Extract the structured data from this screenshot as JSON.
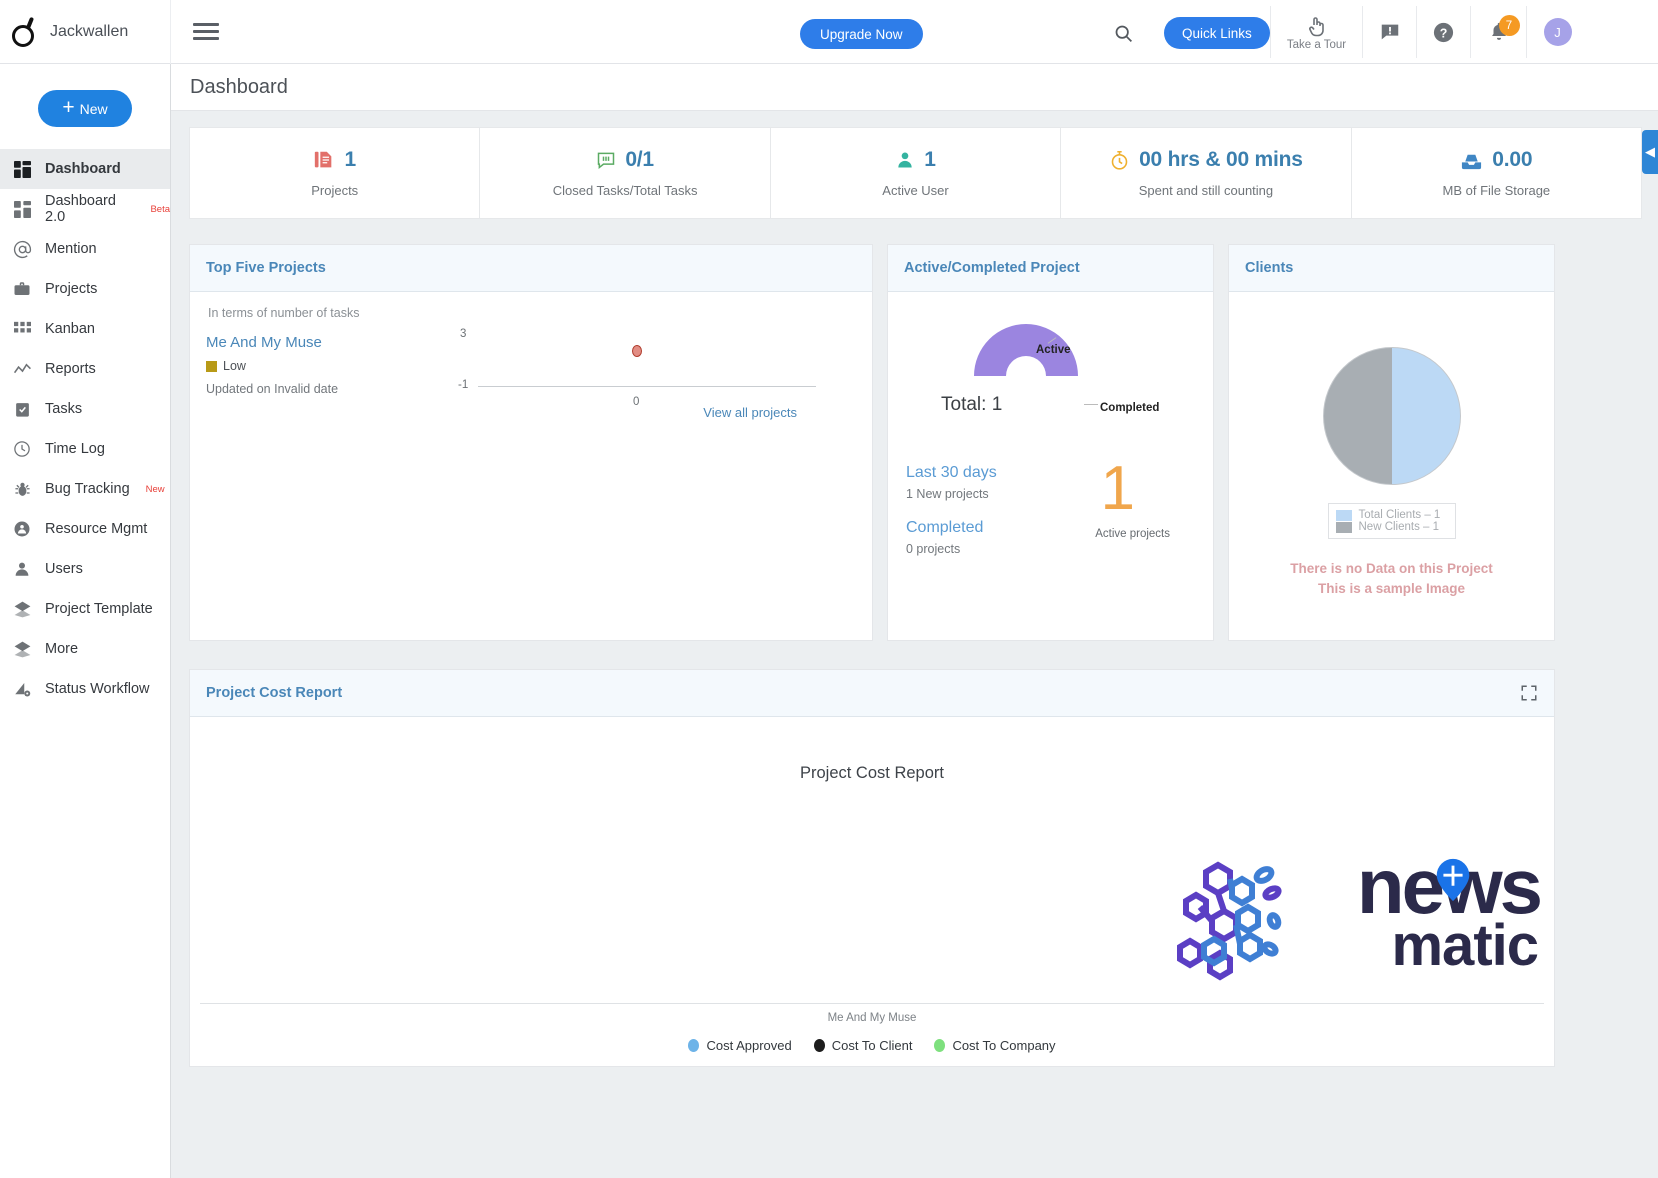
{
  "topbar": {
    "brand_name": "Jackwallen",
    "menu_icon": "hamburger-icon",
    "upgrade_label": "Upgrade Now",
    "search_icon": "search-icon",
    "quick_links_label": "Quick Links",
    "tour_label": "Take a Tour",
    "tour_icon": "hand-pointer-icon",
    "announcement_icon": "announcement-icon",
    "help_icon": "question-circle-icon",
    "bell_icon": "bell-icon",
    "notification_count": "7",
    "avatar_initial": "J"
  },
  "sidebar": {
    "new_label": "New",
    "items": [
      {
        "label": "Dashboard",
        "icon": "dashboard-icon",
        "badge": "",
        "active": true
      },
      {
        "label": "Dashboard 2.0",
        "icon": "dashboard-alt-icon",
        "badge": "Beta",
        "active": false
      },
      {
        "label": "Mention",
        "icon": "at-icon",
        "badge": "",
        "active": false
      },
      {
        "label": "Projects",
        "icon": "briefcase-icon",
        "badge": "",
        "active": false
      },
      {
        "label": "Kanban",
        "icon": "grid-icon",
        "badge": "",
        "active": false
      },
      {
        "label": "Reports",
        "icon": "line-chart-icon",
        "badge": "",
        "active": false
      },
      {
        "label": "Tasks",
        "icon": "clipboard-check-icon",
        "badge": "",
        "active": false
      },
      {
        "label": "Time Log",
        "icon": "clock-icon",
        "badge": "",
        "active": false
      },
      {
        "label": "Bug Tracking",
        "icon": "bug-icon",
        "badge": "New",
        "active": false
      },
      {
        "label": "Resource Mgmt",
        "icon": "users-circle-icon",
        "badge": "",
        "active": false
      },
      {
        "label": "Users",
        "icon": "user-icon",
        "badge": "",
        "active": false
      },
      {
        "label": "Project Template",
        "icon": "layers-icon",
        "badge": "",
        "active": false
      },
      {
        "label": "More",
        "icon": "layers-icon",
        "badge": "",
        "active": false
      },
      {
        "label": "Status Workflow",
        "icon": "workflow-icon",
        "badge": "",
        "active": false
      }
    ]
  },
  "page": {
    "title": "Dashboard"
  },
  "kpis": [
    {
      "value": "1",
      "label": "Projects",
      "icon": "documents-icon",
      "color": "#e2706a"
    },
    {
      "value": "0/1",
      "label": "Closed Tasks/Total Tasks",
      "icon": "task-icon",
      "color": "#5bab63"
    },
    {
      "value": "1",
      "label": "Active User",
      "icon": "person-icon",
      "color": "#34b3a0"
    },
    {
      "value": "00 hrs & 00 mins",
      "label": "Spent and still counting",
      "icon": "stopwatch-icon",
      "color": "#efb02e"
    },
    {
      "value": "0.00",
      "label": "MB of File Storage",
      "icon": "storage-icon",
      "color": "#3f86c4"
    }
  ],
  "top_five": {
    "title": "Top Five Projects",
    "subtitle": "In terms of number of tasks",
    "project_name": "Me And My Muse",
    "priority": "Low",
    "priority_color": "#b89a17",
    "updated": "Updated on Invalid date",
    "view_all_label": "View all projects"
  },
  "active_completed": {
    "title": "Active/Completed Project",
    "label_active": "Active",
    "label_completed": "Completed",
    "total_text": "Total: 1",
    "last30_title": "Last 30 days",
    "last30_sub": "1 New projects",
    "completed_title": "Completed",
    "completed_sub": "0 projects",
    "big_number": "1",
    "big_number_label": "Active projects",
    "arc_color": "#9b85e0"
  },
  "clients": {
    "title": "Clients",
    "legend": [
      {
        "label": "Total Clients – 1",
        "color": "#bcd9f5"
      },
      {
        "label": "New Clients – 1",
        "color": "#a8aeb3"
      }
    ],
    "no_data_line1": "There is no Data on this Project",
    "no_data_line2": "This is a sample Image"
  },
  "cost_report": {
    "title": "Project Cost Report",
    "chart_title": "Project Cost Report",
    "expand_icon": "expand-icon",
    "x_label": "Me And My Muse",
    "legend": [
      {
        "label": "Cost Approved",
        "color": "#6db3e8"
      },
      {
        "label": "Cost To Client",
        "color": "#1d1d1d"
      },
      {
        "label": "Cost To Company",
        "color": "#7ee07e"
      }
    ]
  },
  "watermark": {
    "text_top": "news",
    "text_bottom": "matic"
  },
  "edge_tab": {
    "icon": "chevron-left-icon"
  },
  "chart_data": [
    {
      "type": "scatter",
      "title": "Top Five Projects",
      "subtitle": "In terms of number of tasks",
      "xlabel": "",
      "ylabel": "",
      "categories": [
        "Me And My Muse"
      ],
      "x": [
        0
      ],
      "values": [
        1
      ],
      "ytick_labels": [
        "3",
        "-1"
      ],
      "xtick_labels": [
        "0"
      ],
      "ylim": [
        -1,
        3
      ],
      "grid": false,
      "legend_position": "none",
      "point_color": "#e28d84"
    },
    {
      "type": "pie",
      "title": "Active/Completed Project",
      "labels": [
        "Active",
        "Completed"
      ],
      "values": [
        1,
        0
      ],
      "colors": [
        "#9b85e0",
        "#d7d7d7"
      ],
      "annotation": "Total: 1",
      "donut": true,
      "legend_position": "outside-labels"
    },
    {
      "type": "pie",
      "title": "Clients",
      "labels": [
        "Total Clients – 1",
        "New Clients – 1"
      ],
      "values": [
        1,
        1
      ],
      "colors": [
        "#bcd9f5",
        "#a8aeb3"
      ],
      "legend_position": "bottom",
      "annotation": "There is no Data on this Project / This is a sample Image"
    },
    {
      "type": "bar",
      "title": "Project Cost Report",
      "categories": [
        "Me And My Muse"
      ],
      "xlabel": "Me And My Muse",
      "ylabel": "",
      "series": [
        {
          "name": "Cost Approved",
          "values": [
            0
          ],
          "color": "#6db3e8"
        },
        {
          "name": "Cost To Client",
          "values": [
            0
          ],
          "color": "#1d1d1d"
        },
        {
          "name": "Cost To Company",
          "values": [
            0
          ],
          "color": "#7ee07e"
        }
      ],
      "grid": false,
      "legend_position": "bottom"
    }
  ]
}
